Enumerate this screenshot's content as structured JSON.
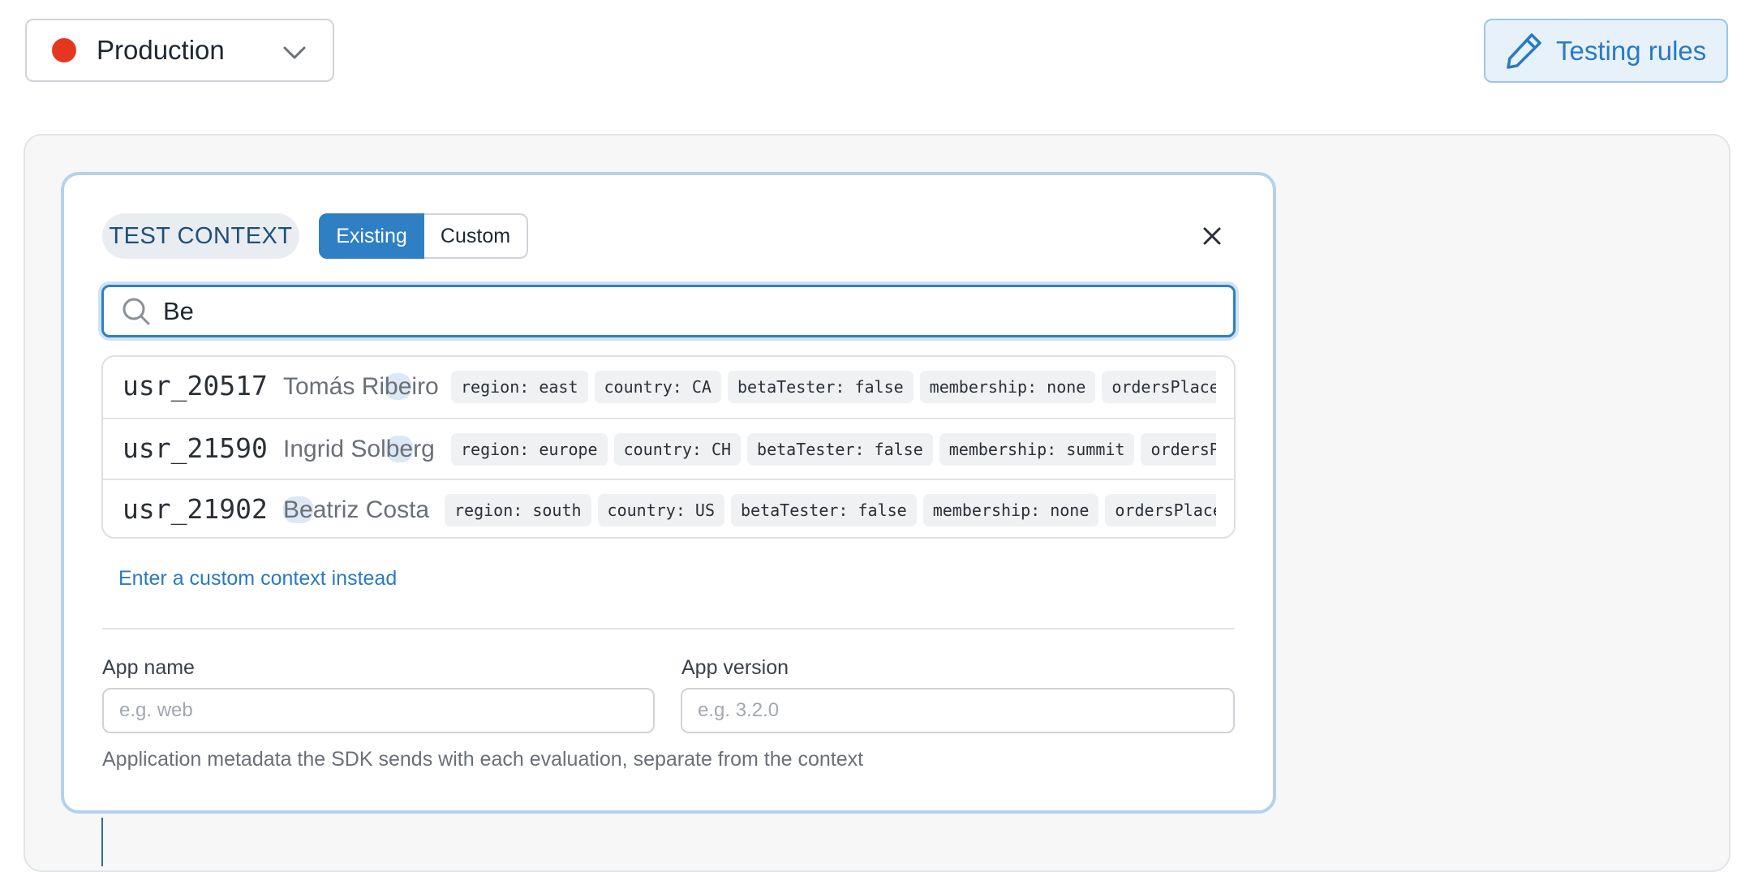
{
  "environment": {
    "name": "Production",
    "dot_color": "#e5371f",
    "icon": "chevron-down-icon"
  },
  "testing_button": {
    "label": "Testing rules",
    "icon": "pencil-icon"
  },
  "panel": {
    "context_badge": "TEST CONTEXT",
    "segments": [
      {
        "label": "Existing",
        "selected": true
      },
      {
        "label": "Custom",
        "selected": false
      }
    ],
    "close_icon": "close-icon",
    "search": {
      "value": "Be",
      "icon": "search-icon"
    },
    "results": [
      {
        "id": "usr_20517",
        "name": {
          "before": "Tomás Ri",
          "match": "be",
          "after": "iro"
        },
        "tags": [
          "region: east",
          "country: CA",
          "betaTester: false",
          "membership: none",
          "ordersPlaced"
        ]
      },
      {
        "id": "usr_21590",
        "name": {
          "before": "Ingrid Sol",
          "match": "be",
          "after": "rg"
        },
        "tags": [
          "region: europe",
          "country: CH",
          "betaTester: false",
          "membership: summit",
          "ordersPlaced"
        ]
      },
      {
        "id": "usr_21902",
        "name": {
          "before": "",
          "match": "Be",
          "after": "atriz Costa"
        },
        "tags": [
          "region: south",
          "country: US",
          "betaTester: false",
          "membership: none",
          "ordersPlaced"
        ]
      }
    ],
    "custom_link": "Enter a custom context instead",
    "app_name": {
      "label": "App name",
      "placeholder": "e.g. web",
      "value": ""
    },
    "app_version": {
      "label": "App version",
      "placeholder": "e.g. 3.2.0",
      "value": ""
    },
    "help_text": "Application metadata the SDK sends with each evaluation, separate from the context"
  },
  "colors": {
    "accent": "#2f7fc5",
    "link": "#2a7ac0",
    "highlight": "#dce8f5"
  }
}
